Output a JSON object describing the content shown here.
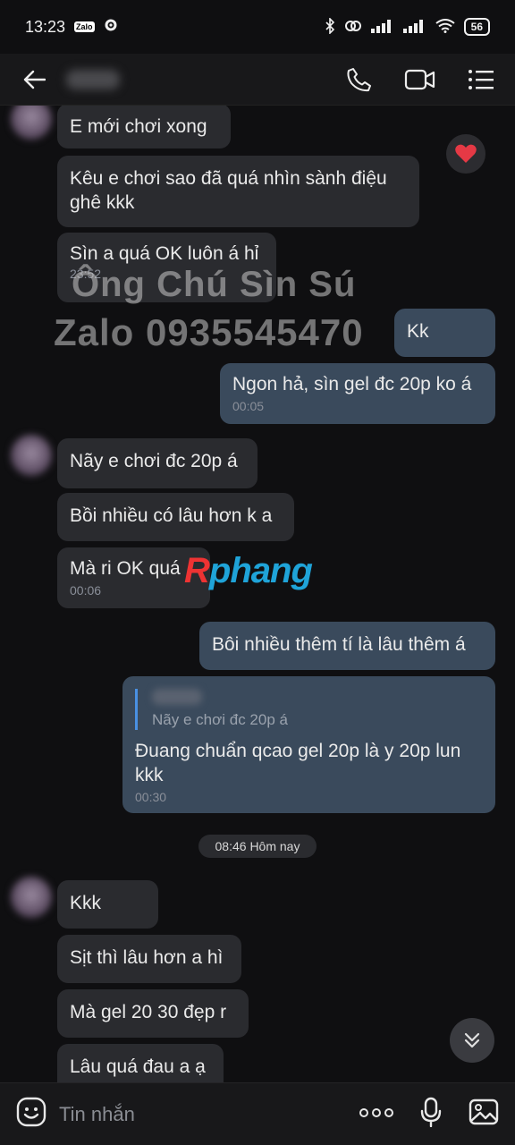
{
  "status_bar": {
    "time": "13:23",
    "app_badge": "Zalo",
    "battery": "56"
  },
  "header": {
    "back_label": "",
    "contact_name": ""
  },
  "watermark": {
    "line1": "Ông Chú Sìn Sú",
    "line2": "Zalo 0935545470",
    "logo_r": "R",
    "logo_rest": "phang"
  },
  "messages": [
    {
      "text": "E mới chơi xong",
      "time": ""
    },
    {
      "text": "Kêu e chơi sao đã quá nhìn sành điệu ghê kkk",
      "time": ""
    },
    {
      "text": "Sìn a quá OK luôn á hỉ",
      "time": "23:52"
    },
    {
      "text": "Kk",
      "time": ""
    },
    {
      "text": "Ngon hả, sìn gel đc 20p ko á",
      "time": "00:05"
    },
    {
      "text": "Nãy e chơi đc 20p á",
      "time": ""
    },
    {
      "text": "Bồi nhiều có lâu hơn k a",
      "time": ""
    },
    {
      "text": "Mà ri OK quá",
      "time": "00:06"
    },
    {
      "text": "Bôi nhiều thêm tí là lâu thêm á",
      "time": ""
    },
    {
      "quote": "Nãy e chơi đc 20p á",
      "text": "Đuang chuẩn qcao gel 20p là y 20p lun kkk",
      "time": "00:30"
    },
    {
      "text": "Kkk",
      "time": ""
    },
    {
      "text": "Sịt thì lâu hơn a hì",
      "time": ""
    },
    {
      "text": "Mà gel 20 30 đẹp r",
      "time": ""
    },
    {
      "text": "Lâu quá đau a ạ",
      "time": ""
    }
  ],
  "date_separator": "08:46 Hôm nay",
  "composer": {
    "placeholder": "Tin nhắn"
  },
  "colors": {
    "incoming_bubble": "#2a2b2f",
    "outgoing_bubble": "#3a4a5c",
    "background": "#0f0f11",
    "reaction": "#e53945",
    "logo_blue": "#1fa3d8",
    "logo_red": "#e33333"
  }
}
